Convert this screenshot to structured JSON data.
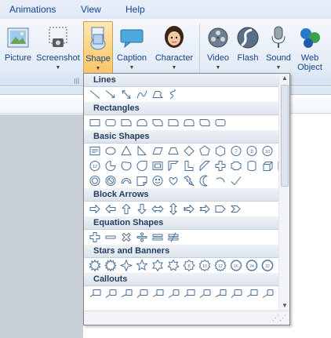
{
  "menu": {
    "items": [
      "Animations",
      "View",
      "Help"
    ]
  },
  "ribbon": {
    "buttons": [
      {
        "label": "Picture",
        "icon": "picture-icon",
        "dropdown": false
      },
      {
        "label": "Screenshot",
        "icon": "screenshot-icon",
        "dropdown": true
      },
      {
        "label": "Shape",
        "icon": "shape-icon",
        "dropdown": true,
        "active": true
      },
      {
        "label": "Caption",
        "icon": "caption-icon",
        "dropdown": true
      },
      {
        "label": "Character",
        "icon": "character-icon",
        "dropdown": true
      },
      {
        "label": "Video",
        "icon": "video-icon",
        "dropdown": true
      },
      {
        "label": "Flash",
        "icon": "flash-icon",
        "dropdown": false
      },
      {
        "label": "Sound",
        "icon": "microphone-icon",
        "dropdown": true
      },
      {
        "label": "Web\nObject",
        "icon": "web-object-icon",
        "dropdown": false
      }
    ],
    "group_label": "Ill"
  },
  "shapes_gallery": {
    "categories": [
      {
        "name": "Lines",
        "rows": [
          [
            "line",
            "arrow",
            "double-arrow",
            "curve",
            "freeform",
            "scribble"
          ]
        ]
      },
      {
        "name": "Rectangles",
        "rows": [
          [
            "rect",
            "rounded-rect",
            "snip-one",
            "snip-two",
            "snip-diag",
            "round-one",
            "round-two",
            "round-diag",
            "rounded-rect"
          ]
        ]
      },
      {
        "name": "Basic Shapes",
        "rows": [
          [
            "text-box",
            "oval",
            "triangle",
            "right-triangle",
            "parallelogram",
            "trapezoid",
            "diamond",
            "pentagon",
            "hexagon",
            "heptagon",
            "octagon",
            "decagon"
          ],
          [
            "dodecagon",
            "pie",
            "chord",
            "teardrop",
            "frame",
            "half-frame",
            "l-shape",
            "diagonal-stripe",
            "cross",
            "plaque",
            "can",
            "cube",
            "bevel"
          ],
          [
            "donut",
            "no-symbol",
            "block-arc",
            "folded-corner",
            "smiley",
            "heart",
            "lightning",
            "moon",
            "arc",
            "check"
          ]
        ]
      },
      {
        "name": "Block Arrows",
        "rows": [
          [
            "right-arrow",
            "left-arrow",
            "up-arrow",
            "down-arrow",
            "left-right-arrow",
            "up-down-arrow",
            "striped-right-arrow",
            "notched-arrow",
            "pentagon-arrow",
            "chevron"
          ]
        ]
      },
      {
        "name": "Equation Shapes",
        "rows": [
          [
            "plus",
            "minus",
            "multiply",
            "divide",
            "equal",
            "not-equal"
          ]
        ]
      },
      {
        "name": "Stars and Banners",
        "rows": [
          [
            "explosion-1",
            "explosion-2",
            "star-4",
            "star-5",
            "star-6",
            "star-7",
            "star-8",
            "star-10",
            "star-12",
            "star-16",
            "star-24",
            "star-32"
          ]
        ]
      },
      {
        "name": "Callouts",
        "rows": [
          [
            "line-callout-1",
            "line-callout-2",
            "line-callout-3",
            "line-callout-4",
            "line-callout-5",
            "line-callout-6",
            "line-callout-7",
            "line-callout-8",
            "line-callout-9",
            "line-callout-10",
            "line-callout-11",
            "line-callout-12"
          ]
        ]
      }
    ]
  },
  "colors": {
    "accent": "#f8c05c",
    "shape_stroke": "#4a6f9a",
    "header_text": "#253d5e",
    "ribbon_text": "#15428b"
  }
}
